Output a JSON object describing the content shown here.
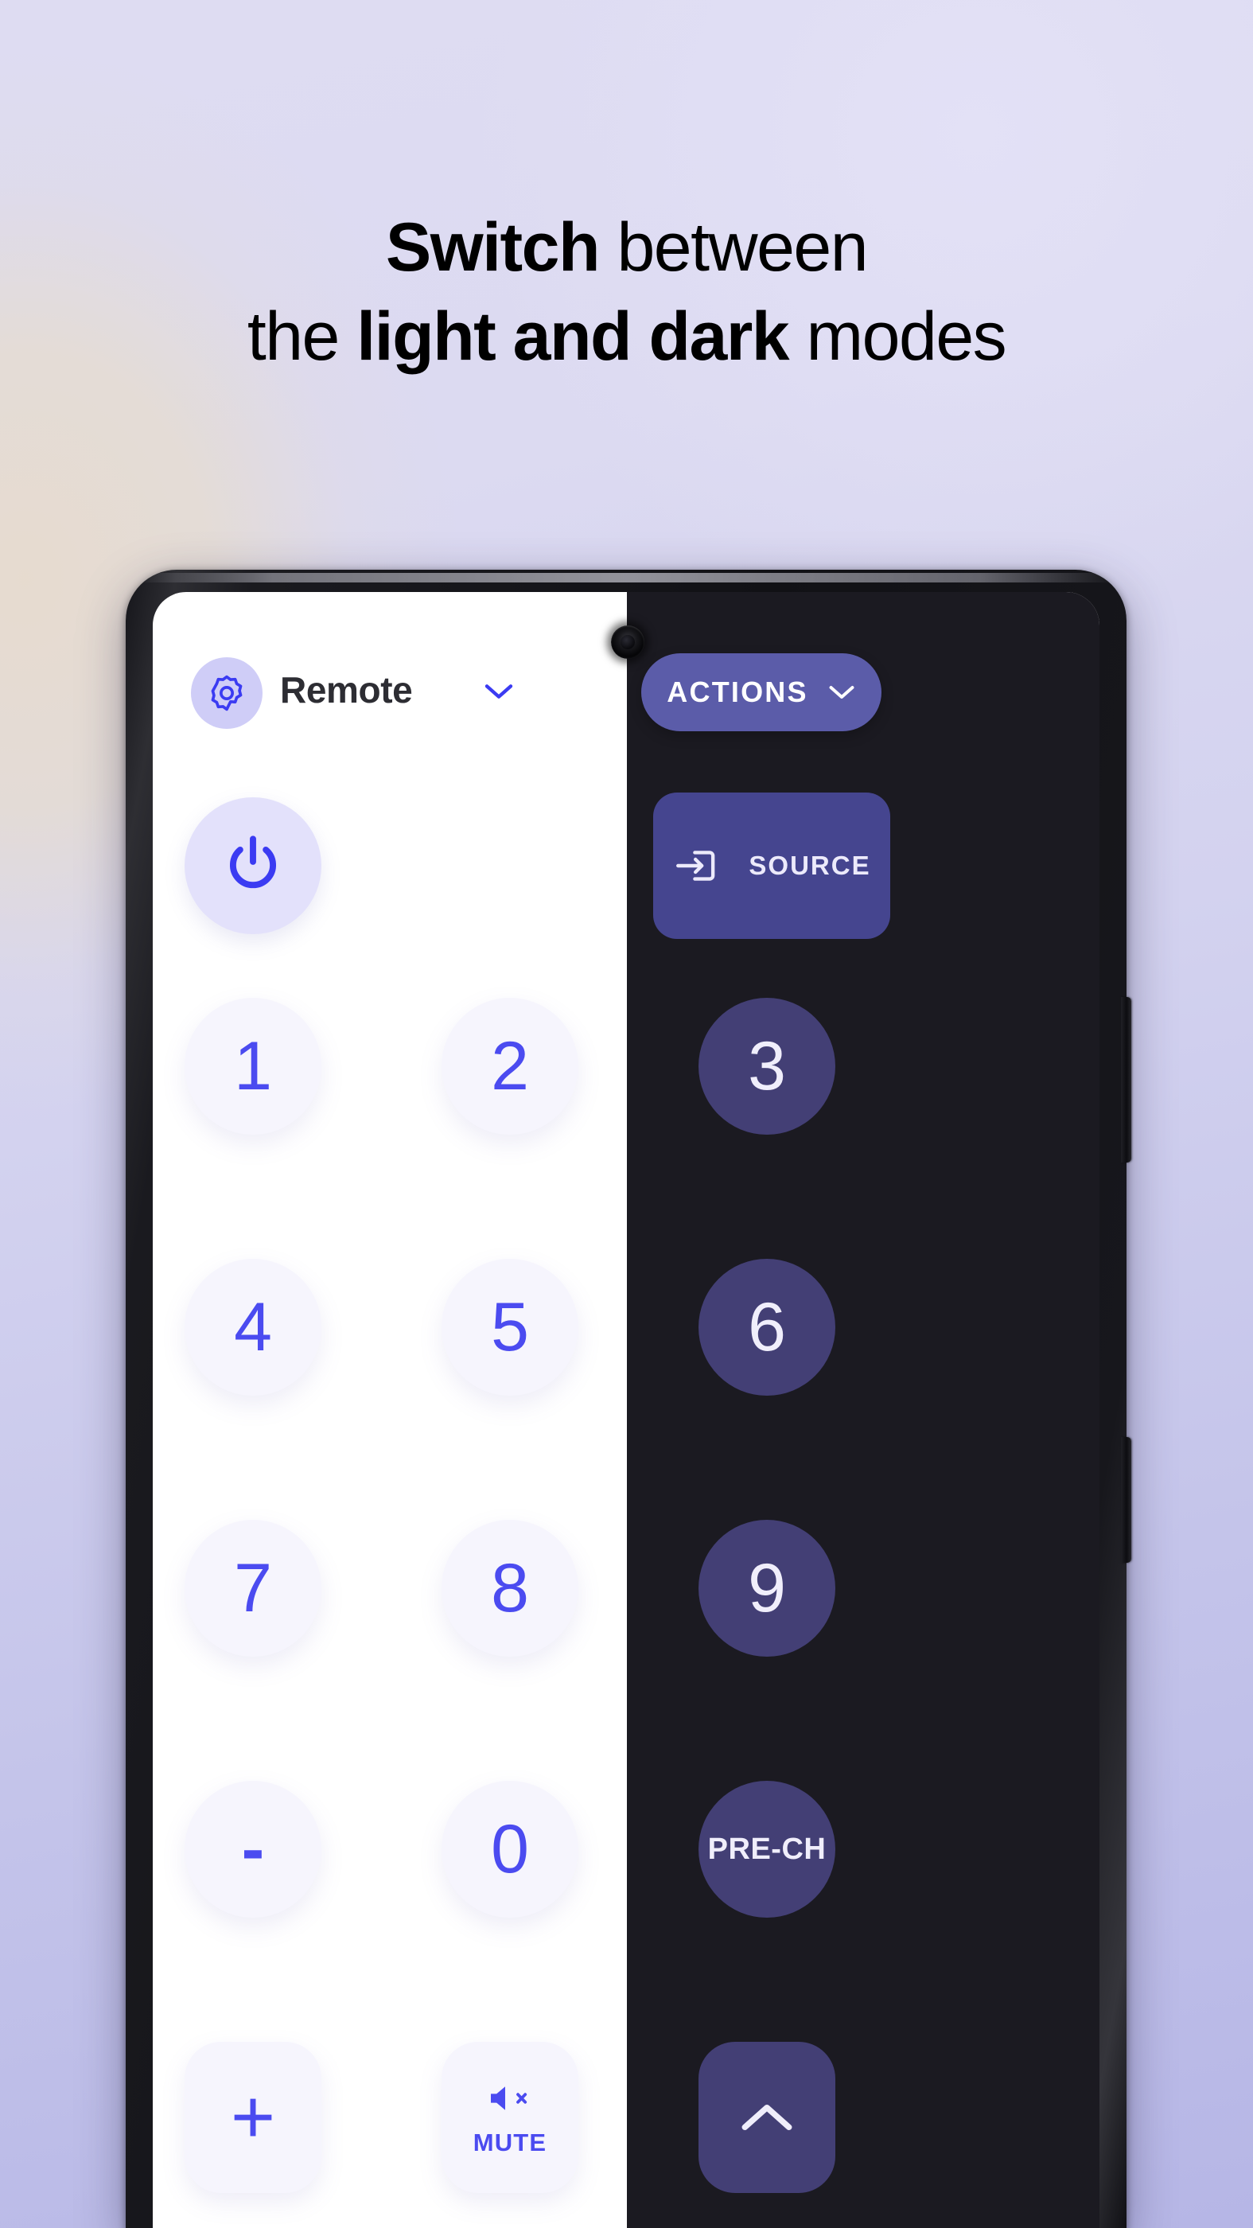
{
  "headline": {
    "line1_bold": "Switch",
    "line1_rest": " between",
    "line2_pre": "the ",
    "line2_bold": "light and dark",
    "line2_rest": " modes"
  },
  "colors": {
    "background_top": "#dedcf2",
    "background_bottom": "#b6b6e6",
    "background_warm_glow": "#e7dbce",
    "accent_blue": "#4b4bf0",
    "accent_indigo": "#45458f",
    "actions_pill": "#5b5ca9",
    "light_surface": "#f6f5fd",
    "dark_surface": "#433f75",
    "dark_background": "#1b1a21",
    "light_background": "#ffffff",
    "gear_chip_light": "#cfcdf7",
    "gear_chip_dark": "#33324a"
  },
  "phone": {
    "frame_color": "#111115",
    "side_buttons": [
      "volume-rocker",
      "power-key"
    ],
    "camera": "punch-hole-camera"
  },
  "app": {
    "topbar": {
      "settings_icon": "gear-icon",
      "title": "Remote",
      "title_chevron": "chevron-down-icon",
      "actions_label": "ACTIONS",
      "actions_chevron": "chevron-down-icon"
    },
    "power": {
      "icon": "power-icon",
      "label": ""
    },
    "source": {
      "icon": "input-arrow-icon",
      "label": "SOURCE"
    },
    "keypad": [
      {
        "label": "1",
        "style": "digit"
      },
      {
        "label": "2",
        "style": "digit"
      },
      {
        "label": "3",
        "style": "digit"
      },
      {
        "label": "4",
        "style": "digit"
      },
      {
        "label": "5",
        "style": "digit"
      },
      {
        "label": "6",
        "style": "digit"
      },
      {
        "label": "7",
        "style": "digit"
      },
      {
        "label": "8",
        "style": "digit"
      },
      {
        "label": "9",
        "style": "digit"
      },
      {
        "label": "-",
        "style": "dash"
      },
      {
        "label": "0",
        "style": "digit"
      },
      {
        "label": "PRE-CH",
        "style": "text"
      }
    ],
    "bottom_row": [
      {
        "label": "+",
        "icon": "plus-icon",
        "name": "volume-up-button"
      },
      {
        "label": "MUTE",
        "icon": "speaker-mute-icon",
        "name": "mute-button"
      },
      {
        "label": "",
        "icon": "chevron-up-icon",
        "name": "channel-up-button"
      }
    ]
  }
}
